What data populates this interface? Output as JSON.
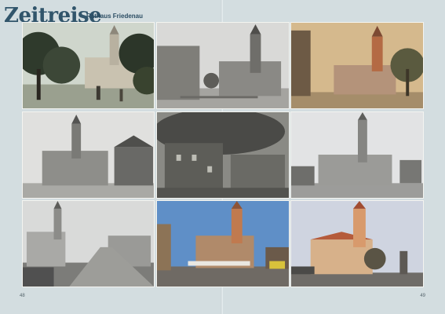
{
  "header": {
    "title": "Zeitreise",
    "subtitle": "Rathaus Friedenau"
  },
  "page_numbers": {
    "left": "48",
    "right": "49"
  },
  "photos": [
    "historic-postcard-park-view",
    "historic-street-rathaus",
    "colored-postcard-rathaus",
    "bw-rathaus-corner",
    "wartime-burning-building",
    "bw-rathaus-square",
    "postwar-street-overview",
    "modern-market-rathaus",
    "modern-rathaus-evening"
  ]
}
